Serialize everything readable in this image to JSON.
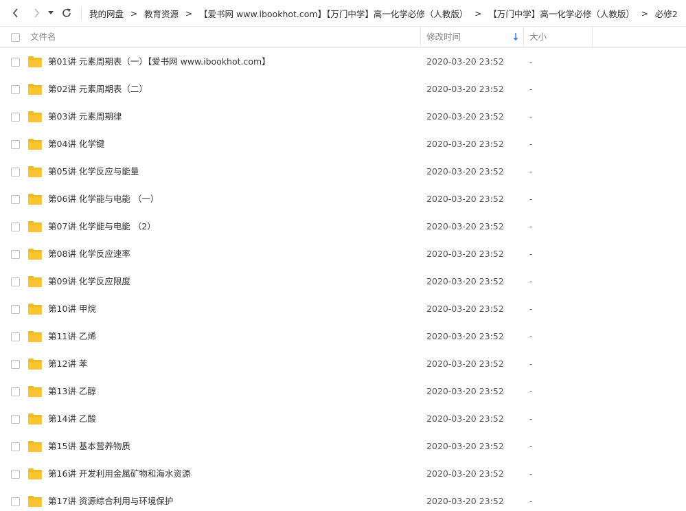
{
  "nav": {
    "back_icon": "chevron-left-icon",
    "forward_icon": "chevron-right-icon",
    "history_icon": "caret-down-icon",
    "refresh_icon": "refresh-icon"
  },
  "breadcrumb": [
    "我的网盘",
    "教育资源",
    "【爱书网 www.ibookhot.com】【万门中学】高一化学必修（人教版）",
    "【万门中学】高一化学必修（人教版）",
    "必修2"
  ],
  "breadcrumb_separator": ">",
  "columns": {
    "name": "文件名",
    "modified": "修改时间",
    "size": "大小"
  },
  "colors": {
    "folder": "#f7c531",
    "folder_tab": "#f2b81e",
    "sort_arrow": "#3b8cf0",
    "text": "#333333"
  },
  "files": [
    {
      "name": "第01讲 元素周期表（一）【爱书网 www.ibookhot.com】",
      "time": "2020-03-20 23:52",
      "size": "-"
    },
    {
      "name": "第02讲 元素周期表（二）",
      "time": "2020-03-20 23:52",
      "size": "-"
    },
    {
      "name": "第03讲 元素周期律",
      "time": "2020-03-20 23:52",
      "size": "-"
    },
    {
      "name": "第04讲 化学键",
      "time": "2020-03-20 23:52",
      "size": "-"
    },
    {
      "name": "第05讲 化学反应与能量",
      "time": "2020-03-20 23:52",
      "size": "-"
    },
    {
      "name": "第06讲 化学能与电能 （一）",
      "time": "2020-03-20 23:52",
      "size": "-"
    },
    {
      "name": "第07讲 化学能与电能 （2）",
      "time": "2020-03-20 23:52",
      "size": "-"
    },
    {
      "name": "第08讲 化学反应速率",
      "time": "2020-03-20 23:52",
      "size": "-"
    },
    {
      "name": "第09讲 化学反应限度",
      "time": "2020-03-20 23:52",
      "size": "-"
    },
    {
      "name": "第10讲 甲烷",
      "time": "2020-03-20 23:52",
      "size": "-"
    },
    {
      "name": "第11讲 乙烯",
      "time": "2020-03-20 23:52",
      "size": "-"
    },
    {
      "name": "第12讲 苯",
      "time": "2020-03-20 23:52",
      "size": "-"
    },
    {
      "name": "第13讲 乙醇",
      "time": "2020-03-20 23:52",
      "size": "-"
    },
    {
      "name": "第14讲 乙酸",
      "time": "2020-03-20 23:52",
      "size": "-"
    },
    {
      "name": "第15讲 基本营养物质",
      "time": "2020-03-20 23:52",
      "size": "-"
    },
    {
      "name": "第16讲 开发利用金属矿物和海水资源",
      "time": "2020-03-20 23:52",
      "size": "-"
    },
    {
      "name": "第17讲 资源综合利用与环境保护",
      "time": "2020-03-20 23:52",
      "size": "-"
    }
  ]
}
